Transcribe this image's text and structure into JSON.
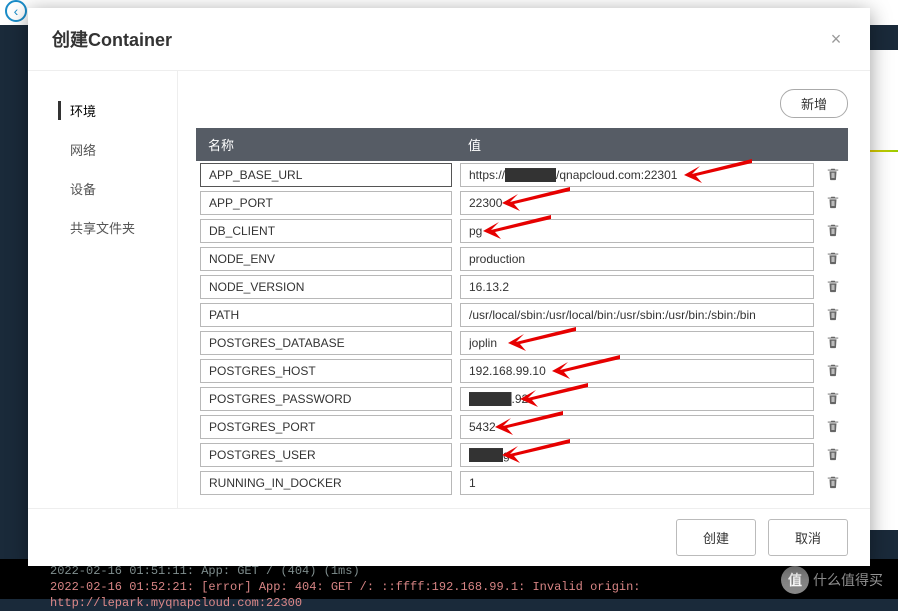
{
  "modal": {
    "title": "创建Container",
    "add_button_label": "新增",
    "create_button_label": "创建",
    "cancel_button_label": "取消",
    "close_label": "×"
  },
  "sidebar": {
    "items": [
      {
        "label": "环境",
        "active": true
      },
      {
        "label": "网络",
        "active": false
      },
      {
        "label": "设备",
        "active": false
      },
      {
        "label": "共享文件夹",
        "active": false
      }
    ]
  },
  "table": {
    "header_name": "名称",
    "header_value": "值"
  },
  "env": [
    {
      "name": "APP_BASE_URL",
      "value": "https://██████/qnapcloud.com:22301",
      "arrow": true,
      "focused": true
    },
    {
      "name": "APP_PORT",
      "value": "22300",
      "arrow": true
    },
    {
      "name": "DB_CLIENT",
      "value": "pg",
      "arrow": true
    },
    {
      "name": "NODE_ENV",
      "value": "production",
      "arrow": false
    },
    {
      "name": "NODE_VERSION",
      "value": "16.13.2",
      "arrow": false
    },
    {
      "name": "PATH",
      "value": "/usr/local/sbin:/usr/local/bin:/usr/sbin:/usr/bin:/sbin:/bin",
      "arrow": false
    },
    {
      "name": "POSTGRES_DATABASE",
      "value": "joplin",
      "arrow": true
    },
    {
      "name": "POSTGRES_HOST",
      "value": "192.168.99.10",
      "arrow": true
    },
    {
      "name": "POSTGRES_PASSWORD",
      "value": "█████.92",
      "arrow": true
    },
    {
      "name": "POSTGRES_PORT",
      "value": "5432",
      "arrow": true
    },
    {
      "name": "POSTGRES_USER",
      "value": "████g",
      "arrow": true
    },
    {
      "name": "RUNNING_IN_DOCKER",
      "value": "1",
      "arrow": false
    }
  ],
  "terminal": {
    "line1": "2022-02-16 01:51:11: App: GET / (404) (1ms)",
    "line2": "2022-02-16 01:52:21: [error] App: 404: GET /: ::ffff:192.168.99.1: Invalid origin: http://lepark.myqnapcloud.com:22300"
  },
  "watermark": {
    "text": "什么值得买",
    "icon": "值"
  }
}
